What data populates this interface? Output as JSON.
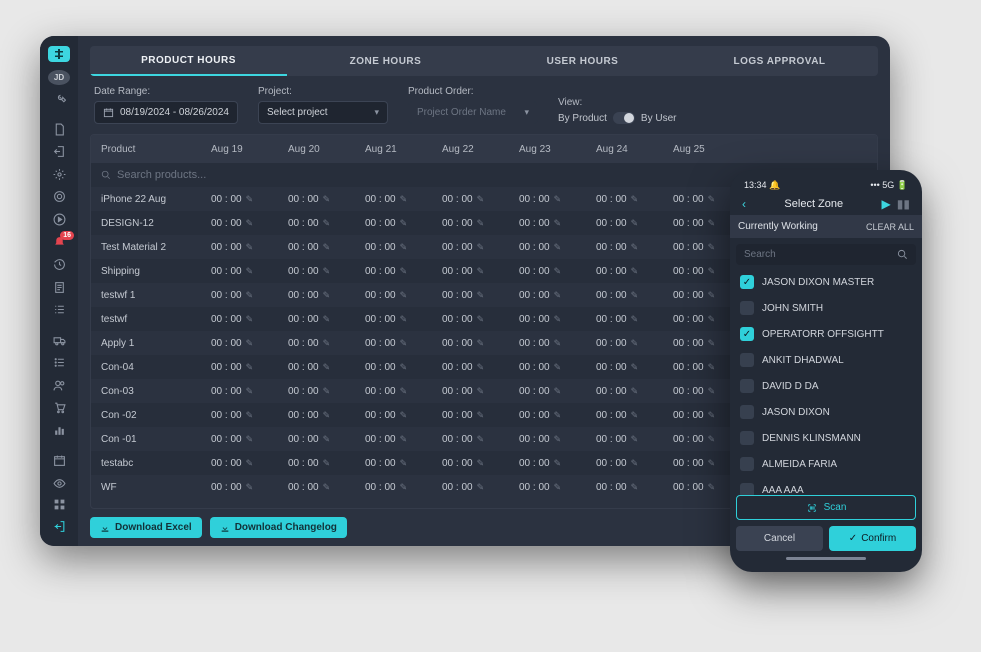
{
  "sidebar": {
    "logo_initials": "JD",
    "badge_count": "16",
    "icons": [
      "wrench",
      "doc",
      "share",
      "gear",
      "target",
      "play",
      "bell",
      "history",
      "file",
      "list",
      "truck",
      "menu",
      "users",
      "cart",
      "chart",
      "empty",
      "calendar",
      "eye"
    ]
  },
  "tabs": [
    {
      "label": "PRODUCT HOURS",
      "active": true
    },
    {
      "label": "ZONE HOURS",
      "active": false
    },
    {
      "label": "USER HOURS",
      "active": false
    },
    {
      "label": "LOGS APPROVAL",
      "active": false
    }
  ],
  "filters": {
    "date_label": "Date Range:",
    "date_value": "08/19/2024 - 08/26/2024",
    "project_label": "Project:",
    "project_value": "Select project",
    "order_label": "Product Order:",
    "order_placeholder": "Project Order Name",
    "view_label": "View:",
    "view_left": "By Product",
    "view_right": "By User"
  },
  "table": {
    "header_product": "Product",
    "dates": [
      "Aug 19",
      "Aug 20",
      "Aug 21",
      "Aug 22",
      "Aug 23",
      "Aug 24",
      "Aug 25"
    ],
    "search_placeholder": "Search products...",
    "cell_default": "00 : 00",
    "rows": [
      "iPhone 22 Aug",
      "DESIGN-12",
      "Test Material 2",
      "Shipping",
      "testwf 1",
      "testwf",
      "Apply 1",
      "Con-04",
      "Con-03",
      "Con -02",
      "Con -01",
      "testabc",
      "WF"
    ]
  },
  "footer": {
    "download_excel": "Download Excel",
    "download_log": "Download Changelog"
  },
  "phone": {
    "time": "13:34",
    "signal": "5G",
    "title": "Select Zone",
    "section": "Currently Working",
    "clear": "CLEAR ALL",
    "search_placeholder": "Search",
    "people": [
      {
        "name": "JASON DIXON MASTER",
        "checked": true
      },
      {
        "name": "JOHN SMITH",
        "checked": false
      },
      {
        "name": "OPERATORR OFFSIGHTT",
        "checked": true
      },
      {
        "name": "ANKIT DHADWAL",
        "checked": false
      },
      {
        "name": "DAVID D DA",
        "checked": false
      },
      {
        "name": "JASON DIXON",
        "checked": false
      },
      {
        "name": "DENNIS KLINSMANN",
        "checked": false
      },
      {
        "name": "ALMEIDA FARIA",
        "checked": false
      },
      {
        "name": "AAA AAA",
        "checked": false
      }
    ],
    "scan": "Scan",
    "cancel": "Cancel",
    "confirm": "Confirm"
  }
}
